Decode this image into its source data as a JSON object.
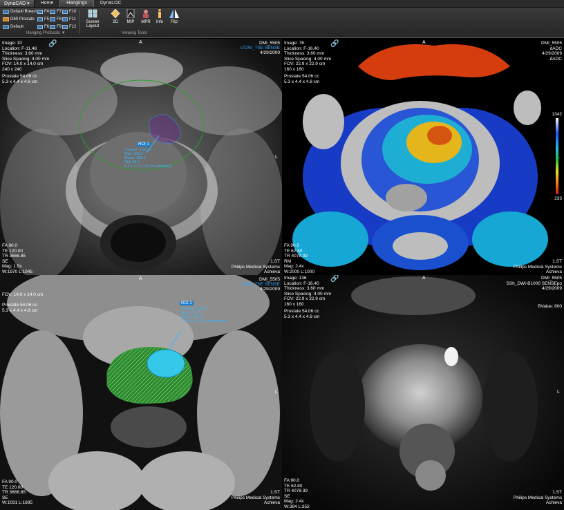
{
  "app": {
    "menu_label": "DynaCAD",
    "tabs": [
      "Home",
      "Hangings",
      "DynaLOC"
    ]
  },
  "hanging_protocols": {
    "items": [
      "Default Breast",
      "DMI Prostate",
      "Default"
    ],
    "fkeys": [
      "F4",
      "F5",
      "F6",
      "F7",
      "F8",
      "F9",
      "F10",
      "F11",
      "F12"
    ],
    "group_label": "Hanging Protocols"
  },
  "viewing_tools": {
    "group_label": "Viewing Tools",
    "tools": [
      {
        "label": "Screen Layout",
        "icon": "grid-icon"
      },
      {
        "label": "2D",
        "icon": "diamond-icon"
      },
      {
        "label": "MIP",
        "icon": "mip-icon"
      },
      {
        "label": "MPR",
        "icon": "mpr-icon"
      },
      {
        "label": "Info",
        "icon": "info-icon"
      },
      {
        "label": "Flip",
        "icon": "flip-icon"
      }
    ]
  },
  "viewports": {
    "tl": {
      "top_left": "Image: 10\nLocation: F-11.48\nThickness: 3.60 mm\nSlice Spacing: 4.00 mm\nFOV: 14.0 x 14.0 cm\n240 x 240",
      "prostate": "Prostate 54.06 cc\n5.3 x 4.4 x 4.8 cm",
      "top_right_1": "DMI_5505",
      "top_right_2": "sT2W_TSE SENSE",
      "top_right_3": "4/29/2009",
      "bottom_left": "FA 90.0\nTE 120.00\nTR 3666.85\nSE\nMag: 1.5x\nW:1970 L:1045",
      "bottom_right": "1.ST\nPhilips Medical Systems\nAchieva",
      "orient_top": "A",
      "orient_right": "L",
      "roi_tag": "ROI 1",
      "roi_lines": "Volume: 1.68 cc\nMax: 210.2\nMean: 160.9\nStd: 55.5\n1.2 x 1.1 x 1.5 cm (anterior)"
    },
    "tr": {
      "top_left": "Image: 76\nLocation: F-16.40\nThickness: 3.60 mm\nSlice Spacing: 4.00 mm\nFOV: 22.9 x 22.9 cm\n160 x 160",
      "prostate": "Prostate 54.06 cc\n5.3 x 4.4 x 4.8 cm",
      "top_right": "DMI_5505\ndADC\n4/29/2009\ndADC",
      "bottom_left": "FA 90.0\nTE 62.80\nTR 4078.39\nRM\nMag: 2.4x\nW:2000 L:1000",
      "bottom_right": "1.ST\nPhilips Medical Systems\nAchieva",
      "orient_top": "A",
      "orient_right": "L",
      "cbar_max": "1342",
      "cbar_min": "233"
    },
    "bl": {
      "top_left": "FOV: 14.0 x 14.0 cm",
      "prostate": "Prostate 54.06 cc\n5.3 x 4.4 x 4.8 cm",
      "top_right_1": "DMI_5505",
      "top_right_2": "sT2W_TSE SENSE",
      "top_right_3": "4/29/2009",
      "bottom_left": "FA 90.0\nTE 120.00\nTR 3666.85\nSE\nW:1031 L:1695",
      "bottom_right": "1.ST\nPhilips Medical Systems\nAchieva",
      "orient_top": "A",
      "orient_right": "L",
      "roi_tag": "ROI 1",
      "roi_lines": "Volume: 1.68 cc\nMax: 410.7\nMean: 195.7\n1.2 x 1.1 x 1.5 cm (anterior)"
    },
    "br": {
      "top_left": "Image: 136\nLocation: F-16.40\nThickness: 3.60 mm\nSlice Spacing: 4.00 mm\nFOV: 22.9 x 22.9 cm\n160 x 160",
      "prostate": "Prostate 54.06 cc\n5.3 x 4.4 x 4.8 cm",
      "top_right": "DMI_5505\nSSh_DWI-B1000 SENSEpo\n4/29/2009",
      "bvalue": "BValue: 800",
      "bottom_left": "FA 90.0\nTE 62.80\nTR 4078.39\nSE\nMag: 2.4x\nW:394 L:352",
      "bottom_right": "1.ST\nPhilips Medical Systems\nAchieva",
      "orient_top": "A",
      "orient_right": "L"
    }
  }
}
